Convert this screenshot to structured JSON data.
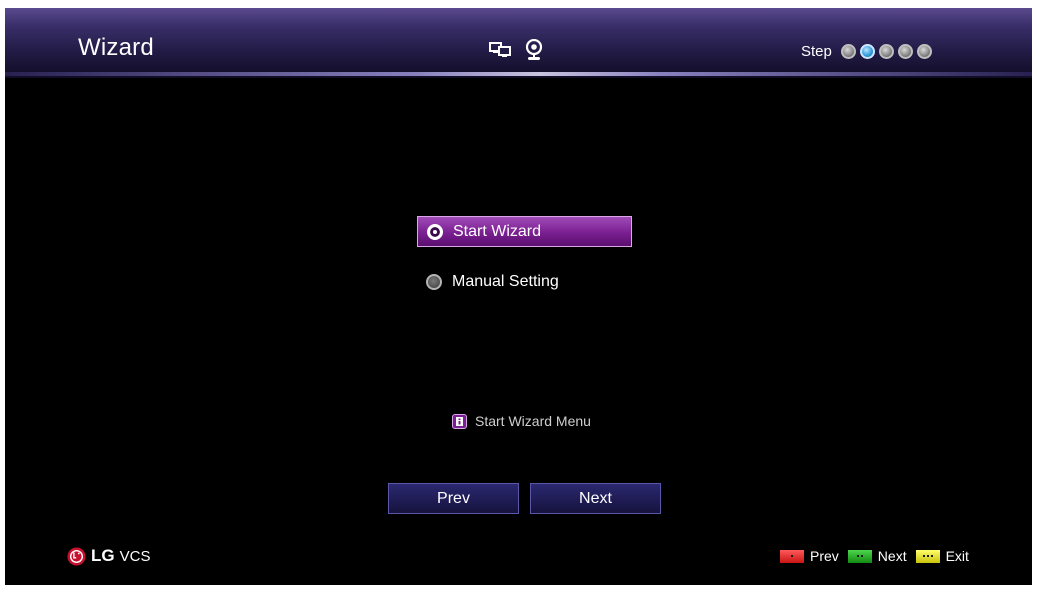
{
  "header": {
    "title": "Wizard",
    "icons": [
      "network-icon",
      "webcam-icon"
    ],
    "step_label": "Step",
    "steps": [
      {
        "state": "inactive"
      },
      {
        "state": "active"
      },
      {
        "state": "inactive"
      },
      {
        "state": "inactive"
      },
      {
        "state": "inactive"
      }
    ],
    "current_step": 2,
    "total_steps": 5
  },
  "options": [
    {
      "label": "Start Wizard",
      "selected": true
    },
    {
      "label": "Manual Setting",
      "selected": false
    }
  ],
  "hint": {
    "icon": "info-icon",
    "text": "Start Wizard Menu"
  },
  "buttons": {
    "prev_label": "Prev",
    "next_label": "Next"
  },
  "brand": {
    "logo_text": "LG",
    "product": "VCS"
  },
  "legend": [
    {
      "color": "red",
      "label": "Prev"
    },
    {
      "color": "green",
      "label": "Next"
    },
    {
      "color": "yellow",
      "label": "Exit"
    }
  ],
  "colors": {
    "background": "#000000",
    "selection": "#7a1f91",
    "step_active": "#36a0e0",
    "button": "#1e1b52"
  }
}
